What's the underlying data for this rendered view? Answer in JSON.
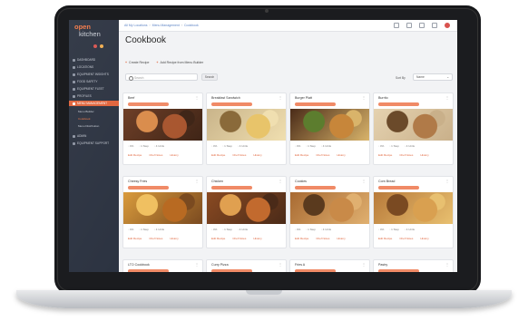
{
  "brand": {
    "logo_top": "open",
    "logo_bottom": "kitchen",
    "accent": "#e0633a"
  },
  "topbar": {
    "crumbs": [
      "All My Locations",
      "Menu Management",
      "Cookbook"
    ],
    "icons": [
      "help-icon",
      "refresh-icon",
      "settings-icon",
      "grid-icon",
      "user-avatar-icon"
    ]
  },
  "sidebar": {
    "items": [
      {
        "label": "DASHBOARD"
      },
      {
        "label": "LOCATIONS"
      },
      {
        "label": "EQUIPMENT INSIGHTS"
      },
      {
        "label": "FOOD SAFETY"
      },
      {
        "label": "EQUIPMENT FLEET"
      },
      {
        "label": "PROFILES"
      },
      {
        "label": "MENU MANAGEMENT"
      },
      {
        "label": "ADMIN"
      },
      {
        "label": "EQUIPMENT SUPPORT"
      }
    ],
    "subitems": [
      {
        "label": "Menu Builder"
      },
      {
        "label": "Cookbook"
      },
      {
        "label": "Menu Distribution"
      }
    ]
  },
  "page": {
    "title": "Cookbook",
    "create_label": "Create Recipe",
    "add_label": "Add Recipe from Menu Builder",
    "search_placeholder": "Search",
    "search_button": "Search",
    "sort_label": "Sort By",
    "sort_value": "Name"
  },
  "cards": [
    {
      "name": "Beef",
      "img": "steak"
    },
    {
      "name": "Breakfast Sandwich",
      "img": "sandwich"
    },
    {
      "name": "Burger Platt",
      "img": "burger"
    },
    {
      "name": "Burrito",
      "img": "burrito"
    },
    {
      "name": "Cheesy Fries",
      "img": "fries"
    },
    {
      "name": "Chicken",
      "img": "chicken"
    },
    {
      "name": "Cookies",
      "img": "cookies"
    },
    {
      "name": "Corn Bread",
      "img": "cornbread"
    },
    {
      "name": "LTO Cookbook",
      "img": ""
    },
    {
      "name": "Curry Pizza",
      "img": ""
    },
    {
      "name": "Fries A",
      "img": ""
    },
    {
      "name": "Pastry",
      "img": ""
    }
  ],
  "card_labels": {
    "edit": "Edit Recipe",
    "edit2": "Chef Notes",
    "history": "History",
    "meta": [
      "4%",
      "1 Step",
      "4 Units"
    ]
  }
}
